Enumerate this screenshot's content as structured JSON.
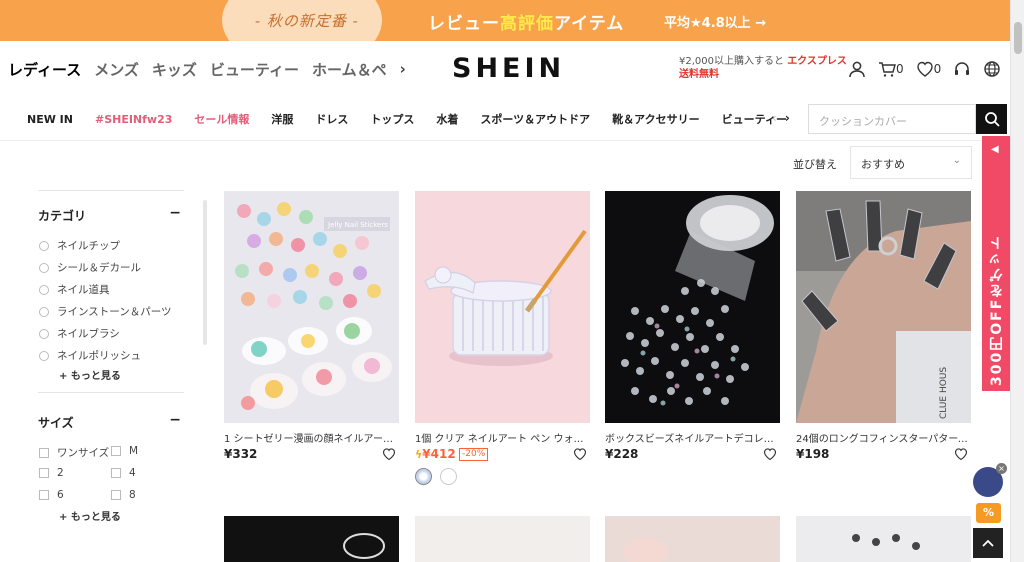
{
  "promo": {
    "left_text": "- 秋の新定番 -",
    "main_prefix": "レビュー",
    "main_highlight": "高評価",
    "main_suffix": "アイテム",
    "right_text": "平均★4.8以上 →"
  },
  "header": {
    "categories": [
      "レディース",
      "メンズ",
      "キッズ",
      "ビューティー",
      "ホーム＆ペ"
    ],
    "logo": "SHEIN",
    "ship_note": "¥2,000以上購入すると",
    "ship_express": "エクスプレス",
    "ship_free": "送料無料",
    "cart_count": "0",
    "wish_count": "0"
  },
  "subnav": {
    "items": [
      "NEW IN",
      "#SHEINfw23",
      "セール情報",
      "洋服",
      "ドレス",
      "トップス",
      "水着",
      "スポーツ＆アウトドア",
      "靴＆アクセサリー",
      "ビューティー"
    ]
  },
  "search": {
    "placeholder": "クッションカバー"
  },
  "sort": {
    "label": "並び替え",
    "selected": "おすすめ"
  },
  "filters": {
    "category": {
      "title": "カテゴリ",
      "options": [
        "ネイルチップ",
        "シール＆デカール",
        "ネイル道具",
        "ラインストーン＆パーツ",
        "ネイルブラシ",
        "ネイルポリッシュ"
      ],
      "more": "+ もっと見る"
    },
    "size": {
      "title": "サイズ",
      "options": [
        "ワンサイズ",
        "M",
        "2",
        "4",
        "6",
        "8"
      ],
      "more": "+ もっと見る"
    }
  },
  "products": [
    {
      "name": "1 シートゼリー漫画の顔ネイルアート…",
      "price": "¥332",
      "sticker_label": "Jelly Nail Stickers"
    },
    {
      "name": "1個 クリア ネイルアート ペン ウォッ…",
      "price": "¥412",
      "discount": "-20%"
    },
    {
      "name": "ボックスビーズネイルアートデコレー…",
      "price": "¥228"
    },
    {
      "name": "24個のロングコフィンスターパターン…",
      "price": "¥198",
      "bottle_text": "CLUE HOUS"
    }
  ],
  "side_promo": {
    "text": "300円OFFをゲット",
    "arrow": "◀"
  },
  "floating": {
    "pct": "%",
    "close": "×"
  }
}
